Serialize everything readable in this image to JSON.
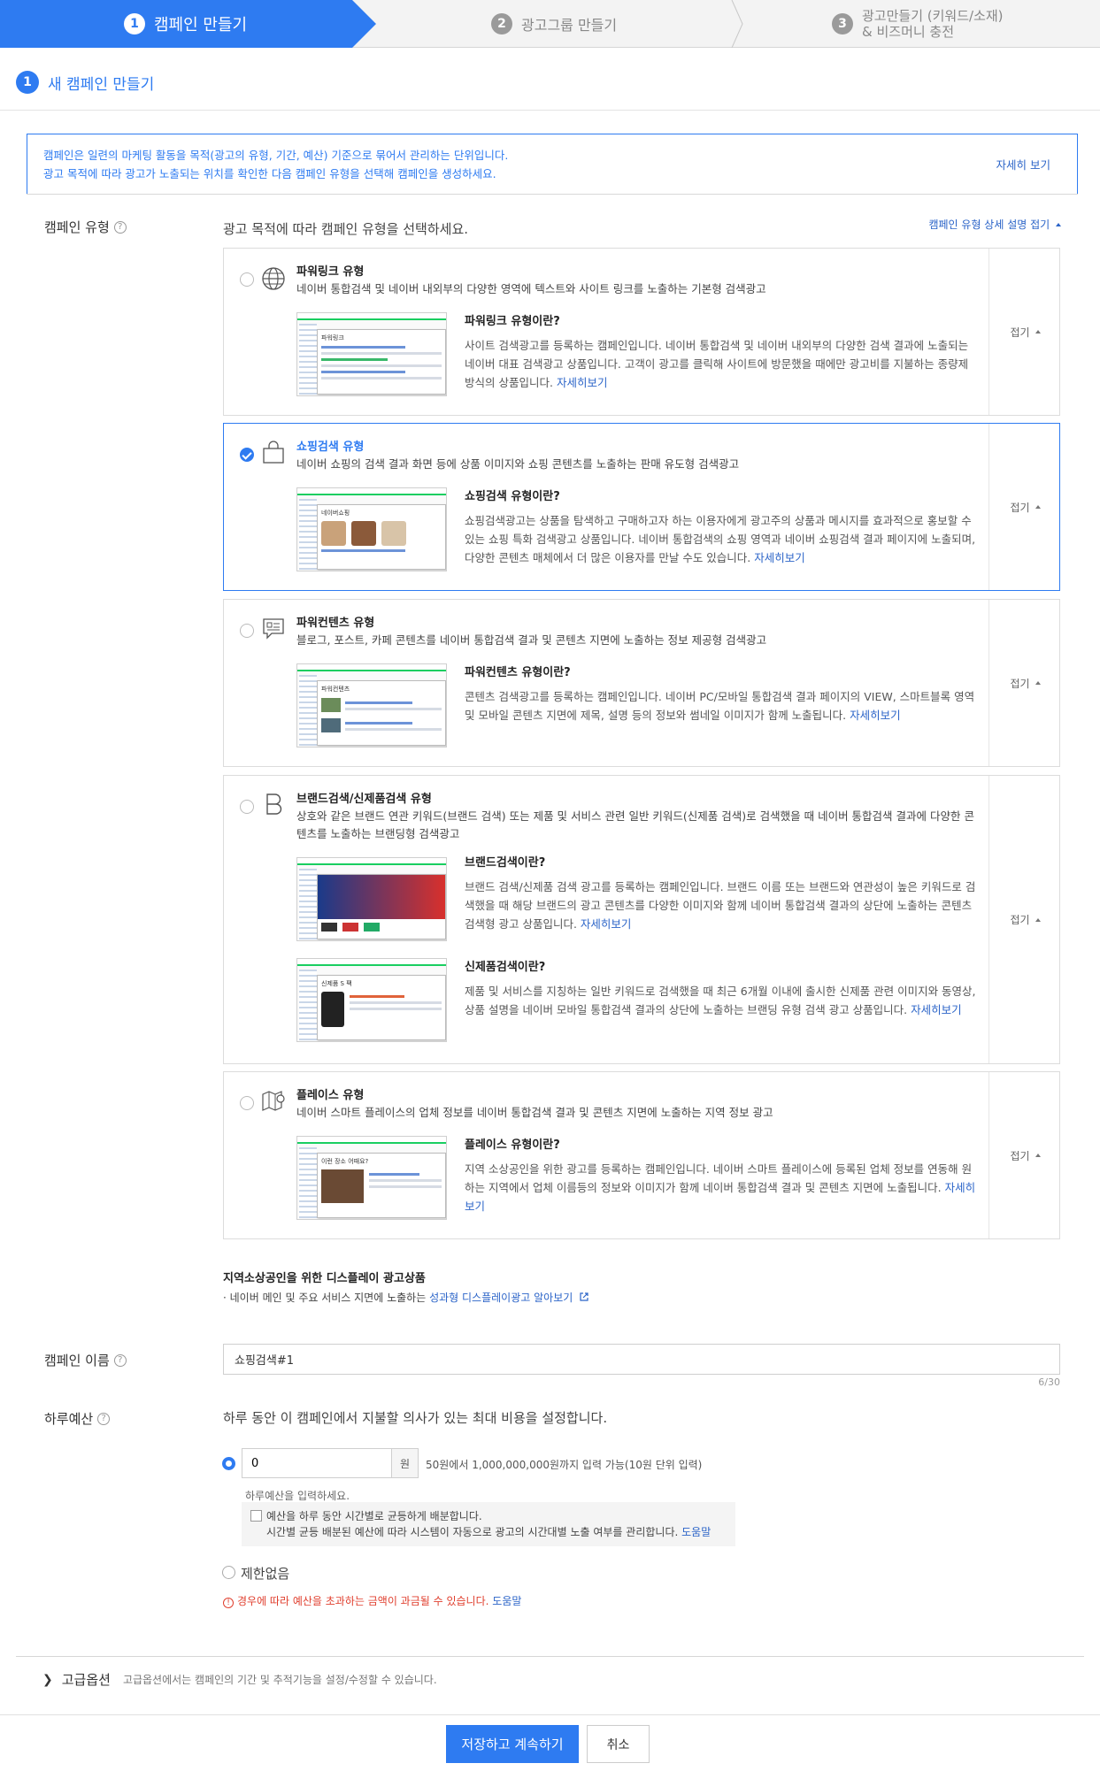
{
  "steps": [
    {
      "num": "1",
      "label": "캠페인 만들기"
    },
    {
      "num": "2",
      "label": "광고그룹 만들기"
    },
    {
      "num": "3",
      "label_line1": "광고만들기 (키워드/소재)",
      "label_line2": "& 비즈머니 충전"
    }
  ],
  "section": {
    "num": "1",
    "title": "새 캠페인 만들기"
  },
  "info": {
    "line1": "캠페인은 일련의 마케팅 활동을 목적(광고의 유형, 기간, 예산) 기준으로 묶어서 관리하는 단위입니다.",
    "line2": "광고 목적에 따라 광고가 노출되는 위치를 확인한 다음 캠페인 유형을 선택해 캠페인을 생성하세요.",
    "more": "자세히 보기"
  },
  "campaign_type": {
    "label": "캠페인 유형",
    "description": "광고 목적에 따라 캠페인 유형을 선택하세요.",
    "toggle": "캠페인 유형 상세 설명 접기",
    "fold_label": "접기",
    "more_link": "자세히보기",
    "types": [
      {
        "title": "파워링크 유형",
        "subtitle": "네이버 통합검색 및 네이버 내외부의 다양한 영역에 텍스트와 사이트 링크를 노출하는 기본형 검색광고",
        "explain_title": "파워링크 유형이란?",
        "explain_text": "사이트 검색광고를 등록하는 캠페인입니다. 네이버 통합검색 및 네이버 내외부의 다양한 검색 결과에 노출되는 네이버 대표 검색광고 상품입니다. 고객이 광고를 클릭해 사이트에 방문했을 때에만 광고비를 지불하는 종량제 방식의 상품입니다.",
        "thumb_title": "파워링크",
        "selected": false,
        "icon": "globe-icon"
      },
      {
        "title": "쇼핑검색 유형",
        "subtitle": "네이버 쇼핑의 검색 결과 화면 등에 상품 이미지와 쇼핑 콘텐츠를 노출하는 판매 유도형 검색광고",
        "explain_title": "쇼핑검색 유형이란?",
        "explain_text": "쇼핑검색광고는 상품을 탐색하고 구매하고자 하는 이용자에게 광고주의 상품과 메시지를 효과적으로 홍보할 수 있는 쇼핑 특화 검색광고 상품입니다. 네이버 통합검색의 쇼핑 영역과 네이버 쇼핑검색 결과 페이지에 노출되며, 다양한 콘텐츠 매체에서 더 많은 이용자를 만날 수도 있습니다.",
        "thumb_title": "네이버쇼핑",
        "selected": true,
        "icon": "shopping-bag-icon"
      },
      {
        "title": "파워컨텐츠 유형",
        "subtitle": "블로그, 포스트, 카페 콘텐츠를 네이버 통합검색 결과 및 콘텐츠 지면에 노출하는 정보 제공형 검색광고",
        "explain_title": "파워컨텐츠 유형이란?",
        "explain_text": "콘텐츠 검색광고를 등록하는 캠페인입니다. 네이버 PC/모바일 통합검색 결과 페이지의 VIEW, 스마트블록 영역 및 모바일 콘텐츠 지면에 제목, 설명 등의 정보와 썸네일 이미지가 함께 노출됩니다.",
        "thumb_title": "파워컨텐츠",
        "selected": false,
        "icon": "content-card-icon"
      },
      {
        "title": "브랜드검색/신제품검색 유형",
        "subtitle": "상호와 같은 브랜드 연관 키워드(브랜드 검색) 또는 제품 및 서비스 관련 일반 키워드(신제품 검색)로 검색했을 때 네이버 통합검색 결과에 다양한 콘텐츠를 노출하는 브랜딩형 검색광고",
        "explain_title": "브랜드검색이란?",
        "explain_text": "브랜드 검색/신제품 검색 광고를 등록하는 캠페인입니다. 브랜드 이름 또는 브랜드와 연관성이 높은 키워드로 검색했을 때 해당 브랜드의 광고 콘텐츠를 다양한 이미지와 함께 네이버 통합검색 결과의 상단에 노출하는 콘텐츠 검색형 광고 상품입니다.",
        "explain2_title": "신제품검색이란?",
        "explain2_text": "제품 및 서비스를 지칭하는 일반 키워드로 검색했을 때 최근 6개월 이내에 출시한 신제품 관련 이미지와 동영상, 상품 설명을 네이버 모바일 통합검색 결과의 상단에 노출하는 브랜딩 유형 검색 광고 상품입니다.",
        "thumb2_title": "신제품 S 팩",
        "selected": false,
        "icon": "brand-b-icon"
      },
      {
        "title": "플레이스 유형",
        "subtitle": "네이버 스마트 플레이스의 업체 정보를 네이버 통합검색 결과 및 콘텐츠 지면에 노출하는 지역 정보 광고",
        "explain_title": "플레이스 유형이란?",
        "explain_text": "지역 소상공인을 위한 광고를 등록하는 캠페인입니다. 네이버 스마트 플레이스에 등록된 업체 정보를 연동해 원하는 지역에서 업체 이름등의 정보와 이미지가 함께 네이버 통합검색 결과 및 콘텐츠 지면에 노출됩니다.",
        "thumb_title": "이런 장소 어때요?",
        "selected": false,
        "icon": "map-pin-icon"
      }
    ]
  },
  "local_display": {
    "title": "지역소상공인을 위한 디스플레이 광고상품",
    "sub_prefix": "· 네이버 메인 및 주요 서비스 지면에 노출하는",
    "sub_link": "성과형 디스플레이광고 알아보기"
  },
  "campaign_name": {
    "label": "캠페인 이름",
    "value": "쇼핑검색#1",
    "count": "6/30"
  },
  "daily_budget": {
    "label": "하루예산",
    "description": "하루 동안 이 캠페인에서 지불할 의사가 있는 최대 비용을 설정합니다.",
    "value": "0",
    "unit": "원",
    "range": "50원에서 1,000,000,000원까지 입력 가능(10원 단위 입력)",
    "hint": "하루예산을 입력하세요.",
    "dist_label": "예산을 하루 동안 시간별로 균등하게 배분합니다.",
    "dist_desc": "시간별 균등 배분된 예산에 따라 시스템이 자동으로 광고의 시간대별 노출 여부를 관리합니다.",
    "help": "도움말",
    "no_limit": "제한없음",
    "warning": "경우에 따라 예산을 초과하는 금액이 과금될 수 있습니다."
  },
  "advanced": {
    "label": "고급옵션",
    "desc": "고급옵션에서는 캠페인의 기간 및 추적기능을 설정/수정할 수 있습니다."
  },
  "buttons": {
    "save": "저장하고 계속하기",
    "cancel": "취소"
  },
  "colors": {
    "primary": "#2e7bf1",
    "warning": "#e03e2d",
    "naver_green": "#19ce60"
  }
}
